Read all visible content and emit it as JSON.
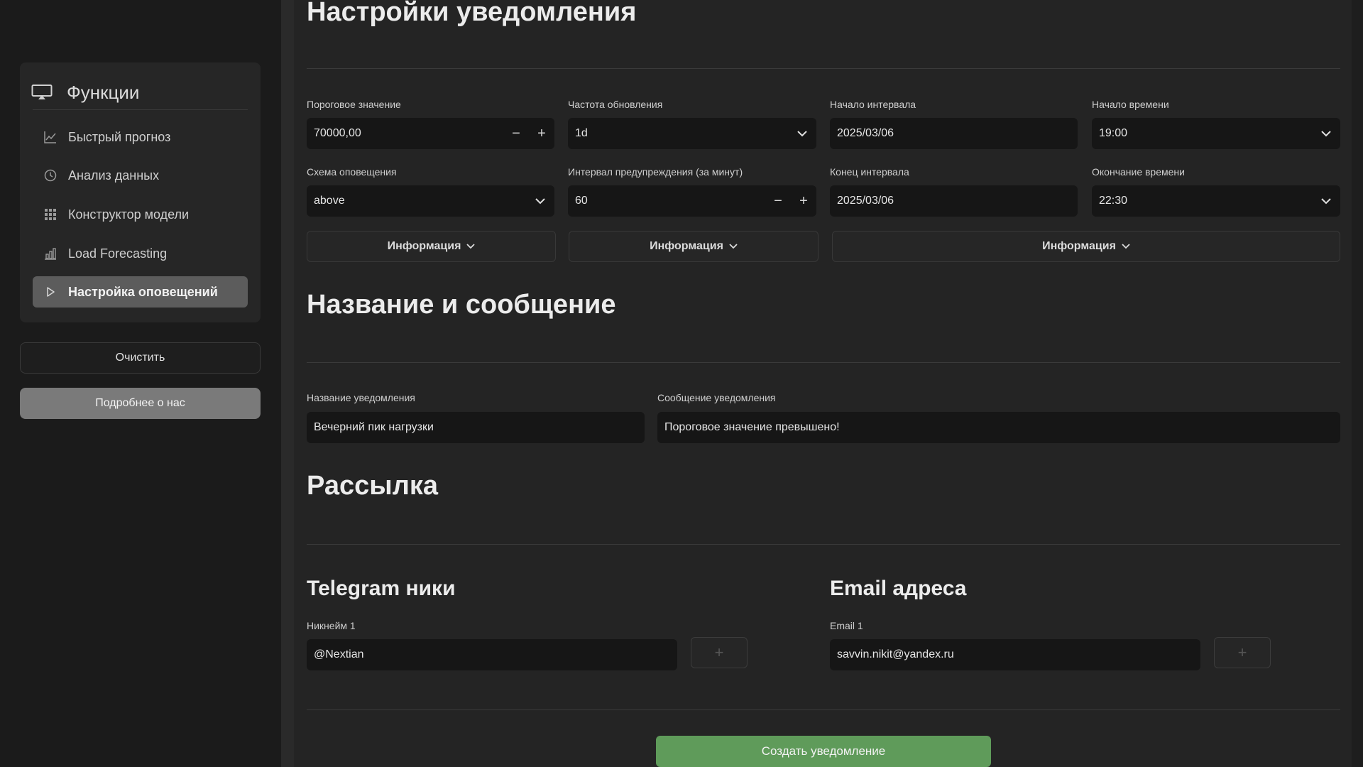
{
  "sidebar": {
    "title": "Функции",
    "title_icon": "monitor-icon",
    "items": [
      {
        "label": "Быстрый прогноз",
        "icon": "line-chart-icon",
        "active": false
      },
      {
        "label": "Анализ данных",
        "icon": "clock-icon",
        "active": false
      },
      {
        "label": "Конструктор модели",
        "icon": "grid-icon",
        "active": false
      },
      {
        "label": "Load Forecasting",
        "icon": "bar-chart-icon",
        "active": false
      },
      {
        "label": "Настройка оповещений",
        "icon": "play-icon",
        "active": true
      }
    ],
    "clear_label": "Очистить",
    "about_label": "Подробнее о нас"
  },
  "notify_settings": {
    "title": "Настройки уведомления",
    "threshold": {
      "label": "Пороговое значение",
      "value": "70000,00",
      "minus": "−",
      "plus": "+"
    },
    "frequency": {
      "label": "Частота обновления",
      "value": "1d"
    },
    "start_date": {
      "label": "Начало интервала",
      "value": "2025/03/06"
    },
    "start_time": {
      "label": "Начало времени",
      "value": "19:00"
    },
    "scheme": {
      "label": "Схема оповещения",
      "value": "above"
    },
    "warn_interval": {
      "label": "Интервал предупреждения (за минут)",
      "value": "60",
      "minus": "−",
      "plus": "+"
    },
    "end_date": {
      "label": "Конец интервала",
      "value": "2025/03/06"
    },
    "end_time": {
      "label": "Окончание времени",
      "value": "22:30"
    },
    "info_label": "Информация"
  },
  "name_message": {
    "title": "Название и сообщение",
    "name": {
      "label": "Название уведомления",
      "value": "Вечерний пик нагрузки"
    },
    "message": {
      "label": "Сообщение уведомления",
      "value": "Пороговое значение превышено!"
    }
  },
  "mailing": {
    "title": "Рассылка",
    "telegram": {
      "title": "Telegram ники",
      "label": "Никнейм 1",
      "value": "@Nextian",
      "add": "+"
    },
    "email": {
      "title": "Email адреса",
      "label": "Email 1",
      "value": "savvin.nikit@yandex.ru",
      "add": "+"
    }
  },
  "create_label": "Создать уведомление",
  "colors": {
    "background": "#242424",
    "sidebar": "#1b1b1b",
    "input": "#161616",
    "active_nav": "#5c5c5c",
    "create_button": "#5f9b5a"
  }
}
